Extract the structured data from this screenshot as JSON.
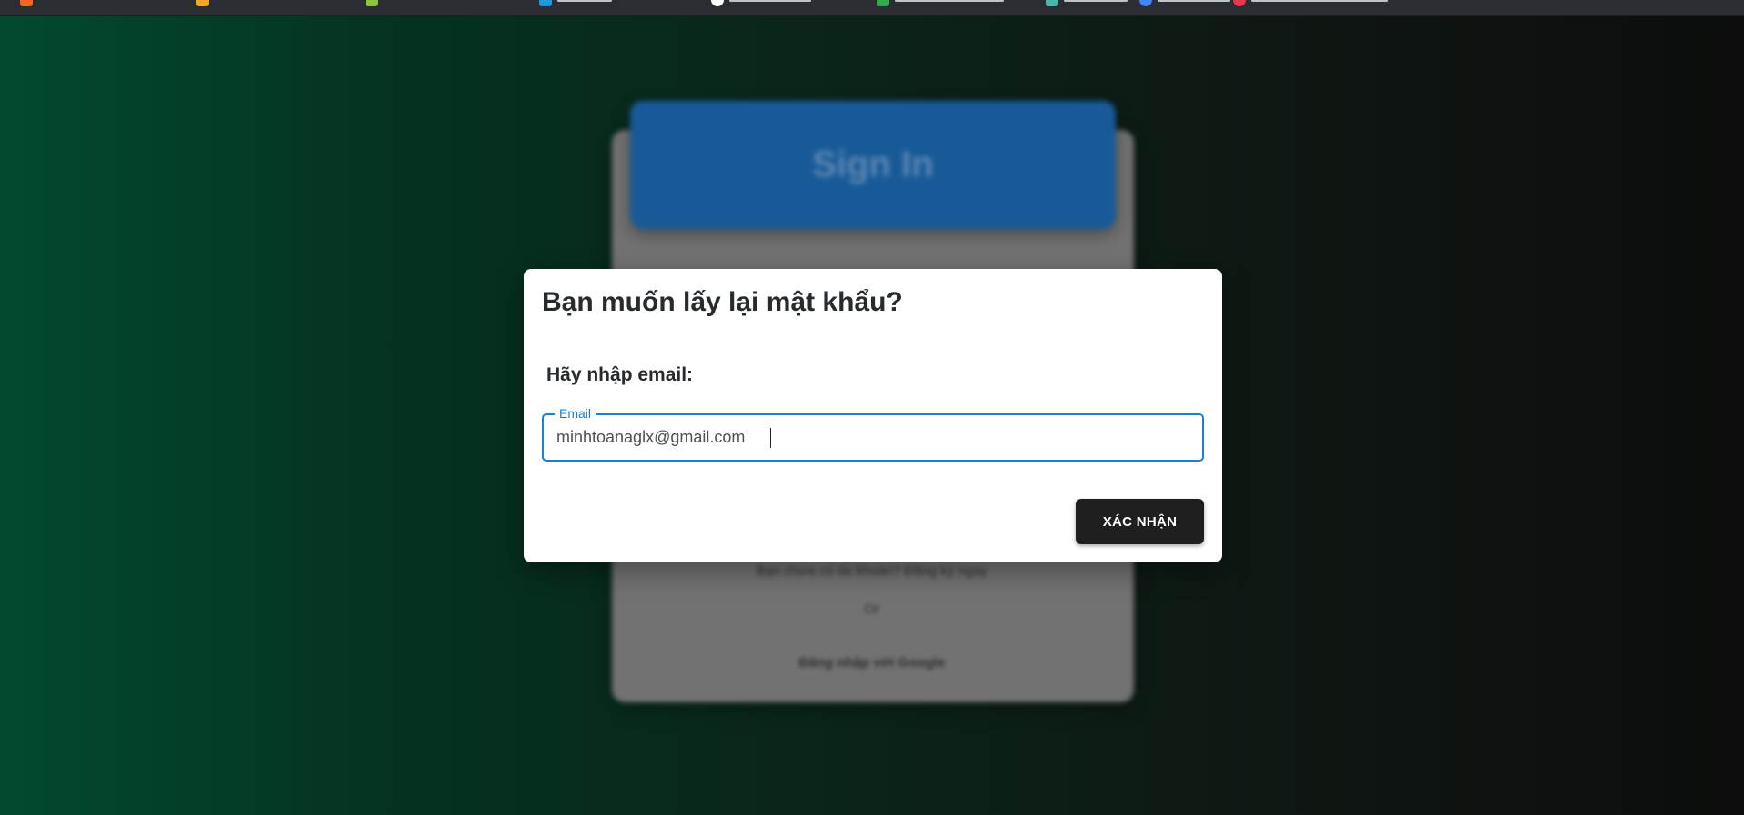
{
  "bookmarks_bar": {
    "items": [
      {
        "icon": "orange-square-icon",
        "color": "#f26522"
      },
      {
        "icon": "yellow-y-icon",
        "color": "#f5a623"
      },
      {
        "icon": "green-cube-icon",
        "color": "#8dc63f"
      },
      {
        "icon": "blue-k-icon",
        "color": "#1a9ad6"
      },
      {
        "icon": "github-icon",
        "color": "#ffffff"
      },
      {
        "icon": "sheets-icon",
        "color": "#34a853"
      },
      {
        "icon": "teal-icon",
        "color": "#4db6ac"
      },
      {
        "icon": "blue-circle-icon",
        "color": "#4285f4"
      },
      {
        "icon": "red-circle-icon",
        "color": "#e53950"
      }
    ]
  },
  "background": {
    "header_title": "Sign In",
    "line1": "Bạn chưa có tài khoản? Đăng ký ngay",
    "line2": "Or",
    "line3": "Đăng nhập với Google"
  },
  "dialog": {
    "title": "Bạn muốn lấy lại mật khẩu?",
    "prompt": "Hãy nhập email:",
    "email_field": {
      "label": "Email",
      "value": "minhtoanaglx@gmail.com"
    },
    "confirm_label": "XÁC NHẬN"
  },
  "colors": {
    "accent": "#1c7ed3",
    "button_bg": "#1f1f1f",
    "header_blue": "#185a98"
  }
}
